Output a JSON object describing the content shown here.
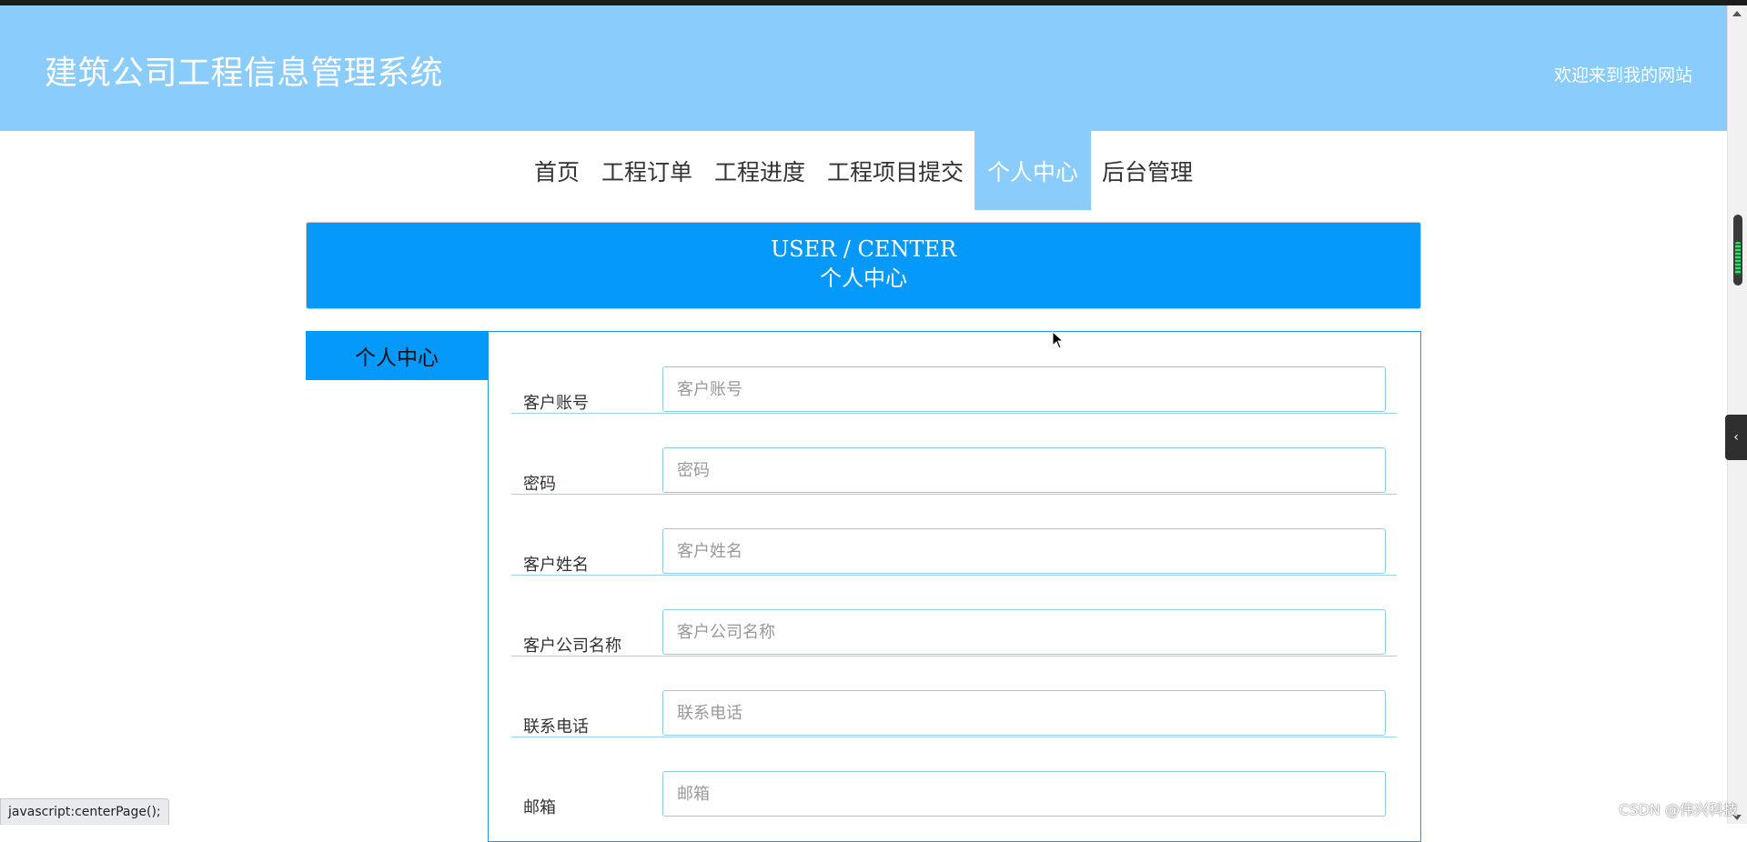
{
  "header": {
    "site_title": "建筑公司工程信息管理系统",
    "welcome": "欢迎来到我的网站",
    "background_color": "#8accfb"
  },
  "nav": {
    "items": [
      {
        "label": "首页",
        "active": false
      },
      {
        "label": "工程订单",
        "active": false
      },
      {
        "label": "工程进度",
        "active": false
      },
      {
        "label": "工程项目提交",
        "active": false
      },
      {
        "label": "个人中心",
        "active": true
      },
      {
        "label": "后台管理",
        "active": false
      }
    ]
  },
  "banner": {
    "title_en": "USER / CENTER",
    "title_cn": "个人中心",
    "background_color": "#0599fb"
  },
  "sidebar": {
    "tab_label": "个人中心"
  },
  "form": {
    "fields": [
      {
        "label": "客户账号",
        "placeholder": "客户账号",
        "value": ""
      },
      {
        "label": "密码",
        "placeholder": "密码",
        "value": ""
      },
      {
        "label": "客户姓名",
        "placeholder": "客户姓名",
        "value": ""
      },
      {
        "label": "客户公司名称",
        "placeholder": "客户公司名称",
        "value": ""
      },
      {
        "label": "联系电话",
        "placeholder": "联系电话",
        "value": ""
      },
      {
        "label": "邮箱",
        "placeholder": "邮箱",
        "value": ""
      }
    ]
  },
  "status_bar": {
    "text": "javascript:centerPage();"
  },
  "watermark": "CSDN @伟兴科技",
  "icons": {
    "side_toggle": "chevron-left-icon",
    "cursor": "mouse-pointer-icon"
  }
}
